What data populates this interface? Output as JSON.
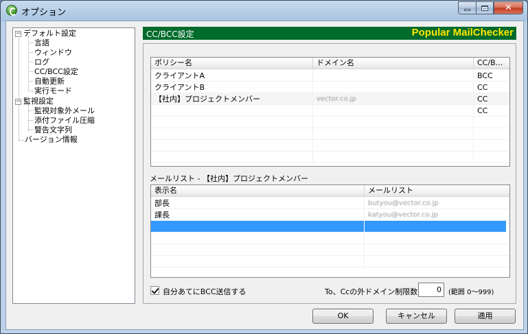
{
  "window": {
    "title": "オプション"
  },
  "tree": {
    "items": [
      {
        "label": "デフォルト設定",
        "expander": "⊟"
      },
      {
        "label": "言語"
      },
      {
        "label": "ウィンドウ"
      },
      {
        "label": "ログ"
      },
      {
        "label": "CC/BCC設定"
      },
      {
        "label": "自動更新"
      },
      {
        "label": "実行モード"
      },
      {
        "label": "監視設定",
        "expander": "⊟"
      },
      {
        "label": "監視対象外メール"
      },
      {
        "label": "添付ファイル圧縮"
      },
      {
        "label": "警告文字列"
      },
      {
        "label": "バージョン情報"
      }
    ]
  },
  "banner": {
    "title": "CC/BCC設定",
    "brand": "Popular MailChecker",
    "bg_color": "#006b2b",
    "brand_color": "#ffe600"
  },
  "policy_list": {
    "columns": [
      "ポリシー名",
      "ドメイン名",
      "CC/B..."
    ],
    "rows": [
      [
        "クライアントA",
        "",
        "BCC"
      ],
      [
        "クライアントB",
        "",
        "CC"
      ],
      [
        "【社内】プロジェクトメンバー",
        "vector.co.jp",
        "CC"
      ],
      [
        "",
        "",
        "CC"
      ]
    ]
  },
  "mail_list": {
    "label": "メールリスト - 【社内】プロジェクトメンバー",
    "columns": [
      "表示名",
      "メールリスト"
    ],
    "rows": [
      [
        "部長",
        "butyou@vector.co.jp"
      ],
      [
        "課長",
        "katyou@vector.co.jp"
      ]
    ],
    "selected_color": "#3399ff"
  },
  "options": {
    "self_bcc_label": "自分あてにBCC送信する",
    "self_bcc_checked": true,
    "limit_label": "To、Ccの外ドメイン制限数:",
    "limit_value": "0",
    "range_label": "(範囲 0～999)"
  },
  "buttons": {
    "ok": "OK",
    "cancel": "キャンセル",
    "apply": "適用"
  }
}
